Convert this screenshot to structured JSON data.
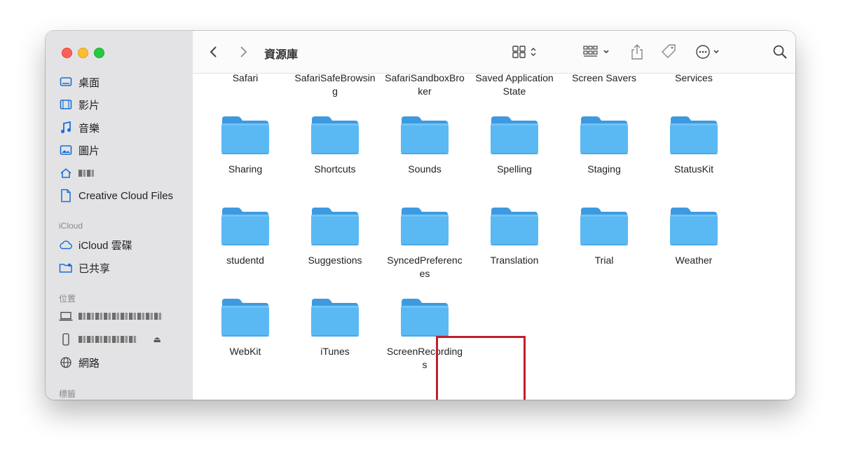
{
  "window": {
    "title": "資源庫"
  },
  "sidebar": {
    "items": [
      {
        "label": "桌面",
        "icon": "desktop-icon"
      },
      {
        "label": "影片",
        "icon": "film-icon"
      },
      {
        "label": "音樂",
        "icon": "music-note-icon"
      },
      {
        "label": "圖片",
        "icon": "photo-icon"
      },
      {
        "label": "",
        "icon": "home-icon"
      },
      {
        "label": "Creative Cloud Files",
        "icon": "document-icon"
      }
    ],
    "sections": {
      "icloud": "iCloud",
      "locations": "位置",
      "tags": "標籤"
    },
    "icloud_items": [
      {
        "label": "iCloud 雲碟",
        "icon": "cloud-icon"
      },
      {
        "label": "已共享",
        "icon": "shared-folder-icon"
      }
    ],
    "location_items": [
      {
        "label": "",
        "icon": "laptop-icon"
      },
      {
        "label": "",
        "icon": "phone-icon"
      },
      {
        "label": "網路",
        "icon": "globe-icon"
      }
    ]
  },
  "toolbar": {
    "icons": [
      "back-icon",
      "forward-icon",
      "grid-view-icon",
      "group-icon",
      "share-icon",
      "tag-icon",
      "more-icon",
      "search-icon"
    ]
  },
  "folders": {
    "row0": [
      "Safari",
      "SafariSafeBrowsin\ng",
      "SafariSandboxBro\nker",
      "Saved Application\nState",
      "Screen Savers",
      "Services"
    ],
    "row1": [
      "Sharing",
      "Shortcuts",
      "Sounds",
      "Spelling",
      "Staging",
      "StatusKit"
    ],
    "row2": [
      "studentd",
      "Suggestions",
      "SyncedPreferenc\nes",
      "Translation",
      "Trial",
      "Weather"
    ],
    "row3": [
      "WebKit",
      "iTunes",
      "ScreenRecording\ns"
    ]
  },
  "colors": {
    "folder_body": "#5ab9f3",
    "folder_tab": "#3d9ae0",
    "highlight": "#c0202a"
  }
}
